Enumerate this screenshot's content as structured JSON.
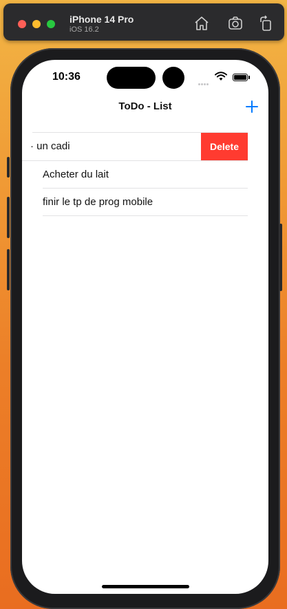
{
  "simulator": {
    "device_name": "iPhone 14 Pro",
    "os_version": "iOS 16.2",
    "toolbar_icons": [
      "home-icon",
      "screenshot-icon",
      "rotate-icon"
    ]
  },
  "status_bar": {
    "time": "10:36"
  },
  "nav": {
    "title": "ToDo - List",
    "add_icon": "plus-icon"
  },
  "todos": [
    {
      "label": "· un cadi",
      "swiped": true
    },
    {
      "label": "Acheter du lait",
      "swiped": false
    },
    {
      "label": "finir le tp de prog mobile",
      "swiped": false
    }
  ],
  "swipe_action": {
    "delete_label": "Delete"
  },
  "colors": {
    "accent": "#007aff",
    "delete": "#ff3b30"
  }
}
